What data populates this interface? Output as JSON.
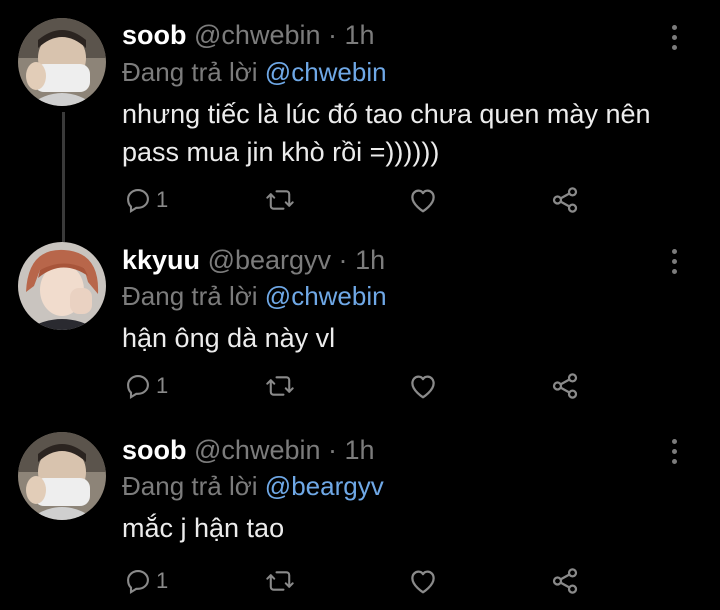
{
  "tweets": [
    {
      "name": "soob",
      "handle": "@chwebin",
      "separator": "·",
      "time": "1h",
      "reply_prefix": "Đang trả lời",
      "reply_handle": "@chwebin",
      "text": "nhưng tiếc là lúc đó tao chưa quen mày nên pass mua jin khò rồi =))))))",
      "reply_count": "1"
    },
    {
      "name": "kkyuu",
      "handle": "@beargyv",
      "separator": "·",
      "time": "1h",
      "reply_prefix": "Đang trả lời",
      "reply_handle": "@chwebin",
      "text": "hận ông dà này vl",
      "reply_count": "1"
    },
    {
      "name": "soob",
      "handle": "@chwebin",
      "separator": "·",
      "time": "1h",
      "reply_prefix": "Đang trả lời",
      "reply_handle": "@beargyv",
      "text": "mắc j hận tao",
      "reply_count": "1"
    }
  ],
  "icons": [
    "reply-icon",
    "retweet-icon",
    "like-icon",
    "share-icon",
    "more-options-icon"
  ],
  "colors": {
    "background": "#000000",
    "name": "#ffffff",
    "muted": "#7c7c7c",
    "link": "#6fa8e6",
    "text": "#ececec"
  }
}
